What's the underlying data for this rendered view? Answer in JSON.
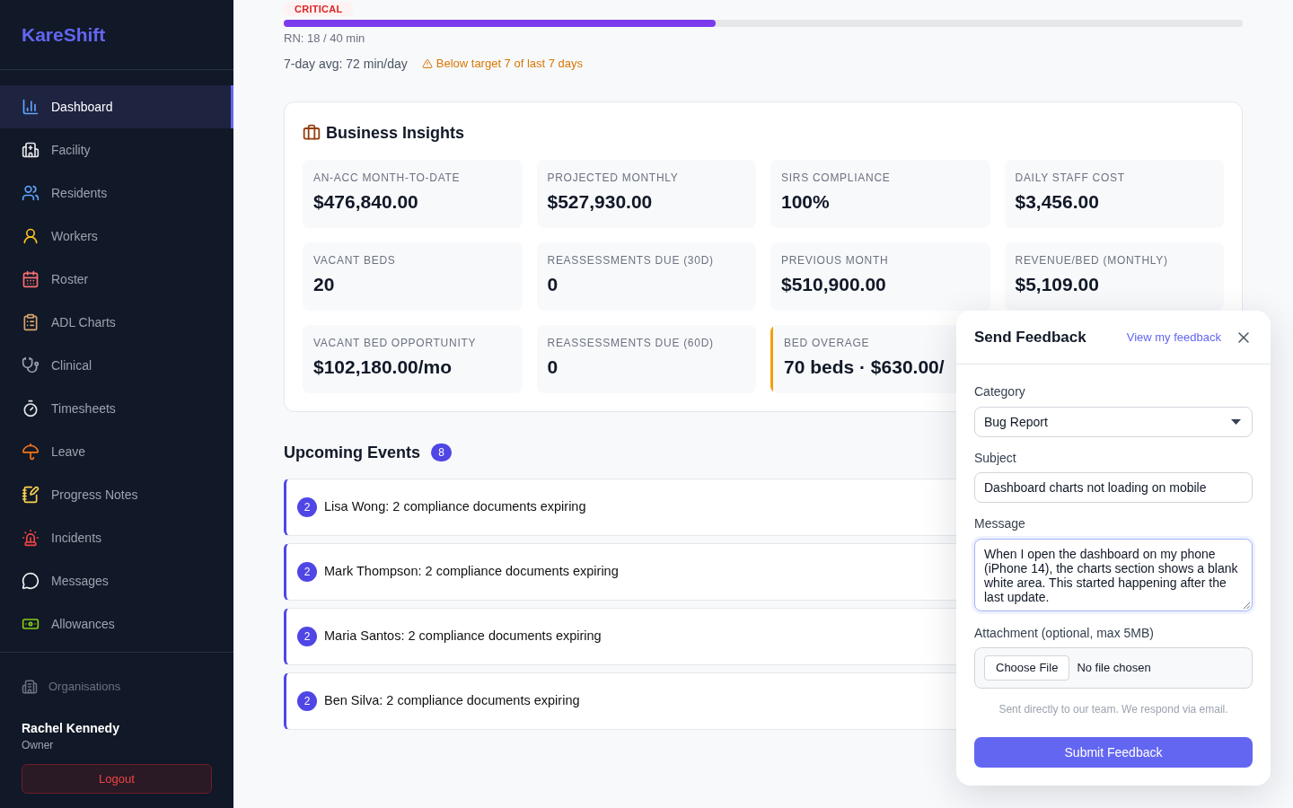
{
  "sidebar": {
    "logo": "KareShift",
    "nav": [
      {
        "label": "Dashboard",
        "selected": true
      },
      {
        "label": "Facility",
        "selected": false
      },
      {
        "label": "Residents",
        "selected": false
      },
      {
        "label": "Workers",
        "selected": false
      },
      {
        "label": "Roster",
        "selected": false
      },
      {
        "label": "ADL Charts",
        "selected": false
      },
      {
        "label": "Clinical",
        "selected": false
      },
      {
        "label": "Timesheets",
        "selected": false
      },
      {
        "label": "Leave",
        "selected": false
      },
      {
        "label": "Progress Notes",
        "selected": false
      },
      {
        "label": "Incidents",
        "selected": false
      },
      {
        "label": "Messages",
        "selected": false
      },
      {
        "label": "Allowances",
        "selected": false
      }
    ],
    "footer_link": "Organisations",
    "user": {
      "name": "Rachel Kennedy",
      "role": "Owner"
    },
    "logout": "Logout"
  },
  "staffing": {
    "badge": "CRITICAL",
    "level": 0.45,
    "reading": "RN: 18 / 40 min",
    "average": "7-day avg: 72 min/day",
    "warning": "Below target 7 of last 7 days"
  },
  "insights": {
    "title": "Business Insights",
    "metrics": [
      {
        "label": "AN-ACC MONTH-TO-DATE",
        "value": "$476,840.00",
        "warning": false
      },
      {
        "label": "PROJECTED MONTHLY",
        "value": "$527,930.00",
        "warning": false
      },
      {
        "label": "SIRS COMPLIANCE",
        "value": "100%",
        "warning": false
      },
      {
        "label": "DAILY STAFF COST",
        "value": "$3,456.00",
        "warning": false
      },
      {
        "label": "VACANT BEDS",
        "value": "20",
        "warning": false
      },
      {
        "label": "REASSESSMENTS DUE (30D)",
        "value": "0",
        "warning": false
      },
      {
        "label": "PREVIOUS MONTH",
        "value": "$510,900.00",
        "warning": false
      },
      {
        "label": "REVENUE/BED (MONTHLY)",
        "value": "$5,109.00",
        "warning": false
      },
      {
        "label": "VACANT BED OPPORTUNITY",
        "value": "$102,180.00/mo",
        "warning": false
      },
      {
        "label": "REASSESSMENTS DUE (60D)",
        "value": "0",
        "warning": false
      },
      {
        "label": "BED OVERAGE",
        "value": "70 beds · $630.00/",
        "warning": true
      }
    ]
  },
  "events": {
    "title": "Upcoming Events",
    "count": "8",
    "items": [
      {
        "count": "2",
        "text": "Lisa Wong: 2 compliance documents expiring"
      },
      {
        "count": "2",
        "text": "Mark Thompson: 2 compliance documents expiring"
      },
      {
        "count": "2",
        "text": "Maria Santos: 2 compliance documents expiring"
      },
      {
        "count": "2",
        "text": "Ben Silva: 2 compliance documents expiring"
      }
    ]
  },
  "feedback": {
    "title": "Send Feedback",
    "view_link": "View my feedback",
    "category": {
      "label": "Category",
      "value": "Bug Report"
    },
    "subject": {
      "label": "Subject",
      "value": "Dashboard charts not loading on mobile"
    },
    "message": {
      "label": "Message",
      "value": "When I open the dashboard on my phone (iPhone 14), the charts section shows a blank white area. This started happening after the last update.",
      "focused": true
    },
    "attachment": {
      "label": "Attachment (optional, max 5MB)",
      "button": "Choose File",
      "status": "No file chosen"
    },
    "hint": "Sent directly to our team. We respond via email.",
    "submit": "Submit Feedback"
  }
}
